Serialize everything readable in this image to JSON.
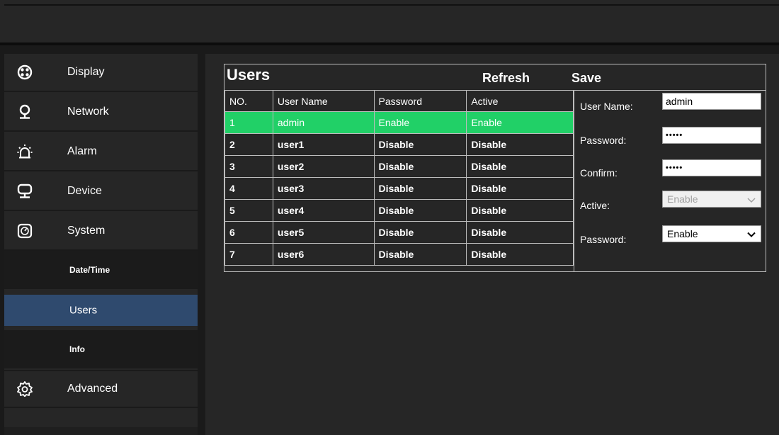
{
  "sidebar": {
    "items": [
      {
        "label": "Display",
        "icon": "display-icon"
      },
      {
        "label": "Network",
        "icon": "network-icon"
      },
      {
        "label": "Alarm",
        "icon": "alarm-icon"
      },
      {
        "label": "Device",
        "icon": "device-icon"
      },
      {
        "label": "System",
        "icon": "system-icon"
      }
    ],
    "sub_items": [
      {
        "label": "Date/Time"
      },
      {
        "label": "Users",
        "active": true
      },
      {
        "label": "Info"
      }
    ],
    "advanced": {
      "label": "Advanced",
      "icon": "gear-icon"
    }
  },
  "users_panel": {
    "title": "Users",
    "refresh_label": "Refresh",
    "save_label": "Save",
    "columns": [
      "NO.",
      "User Name",
      "Password",
      "Active"
    ],
    "rows": [
      {
        "no": "1",
        "name": "admin",
        "password": "Enable",
        "active": "Enable",
        "selected": true
      },
      {
        "no": "2",
        "name": "user1",
        "password": "Disable",
        "active": "Disable"
      },
      {
        "no": "3",
        "name": "user2",
        "password": "Disable",
        "active": "Disable"
      },
      {
        "no": "4",
        "name": "user3",
        "password": "Disable",
        "active": "Disable"
      },
      {
        "no": "5",
        "name": "user4",
        "password": "Disable",
        "active": "Disable"
      },
      {
        "no": "6",
        "name": "user5",
        "password": "Disable",
        "active": "Disable"
      },
      {
        "no": "7",
        "name": "user6",
        "password": "Disable",
        "active": "Disable"
      }
    ]
  },
  "form": {
    "username_label": "User Name:",
    "username_value": "admin",
    "password_label": "Password:",
    "password_value": "•••••",
    "confirm_label": "Confirm:",
    "confirm_value": "•••••",
    "active_label": "Active:",
    "active_value": "Enable",
    "password_enable_label": "Password:",
    "password_enable_value": "Enable"
  },
  "colors": {
    "selected_row": "#21d067",
    "active_nav": "#2f4a6e",
    "panel_bg": "#262626"
  }
}
